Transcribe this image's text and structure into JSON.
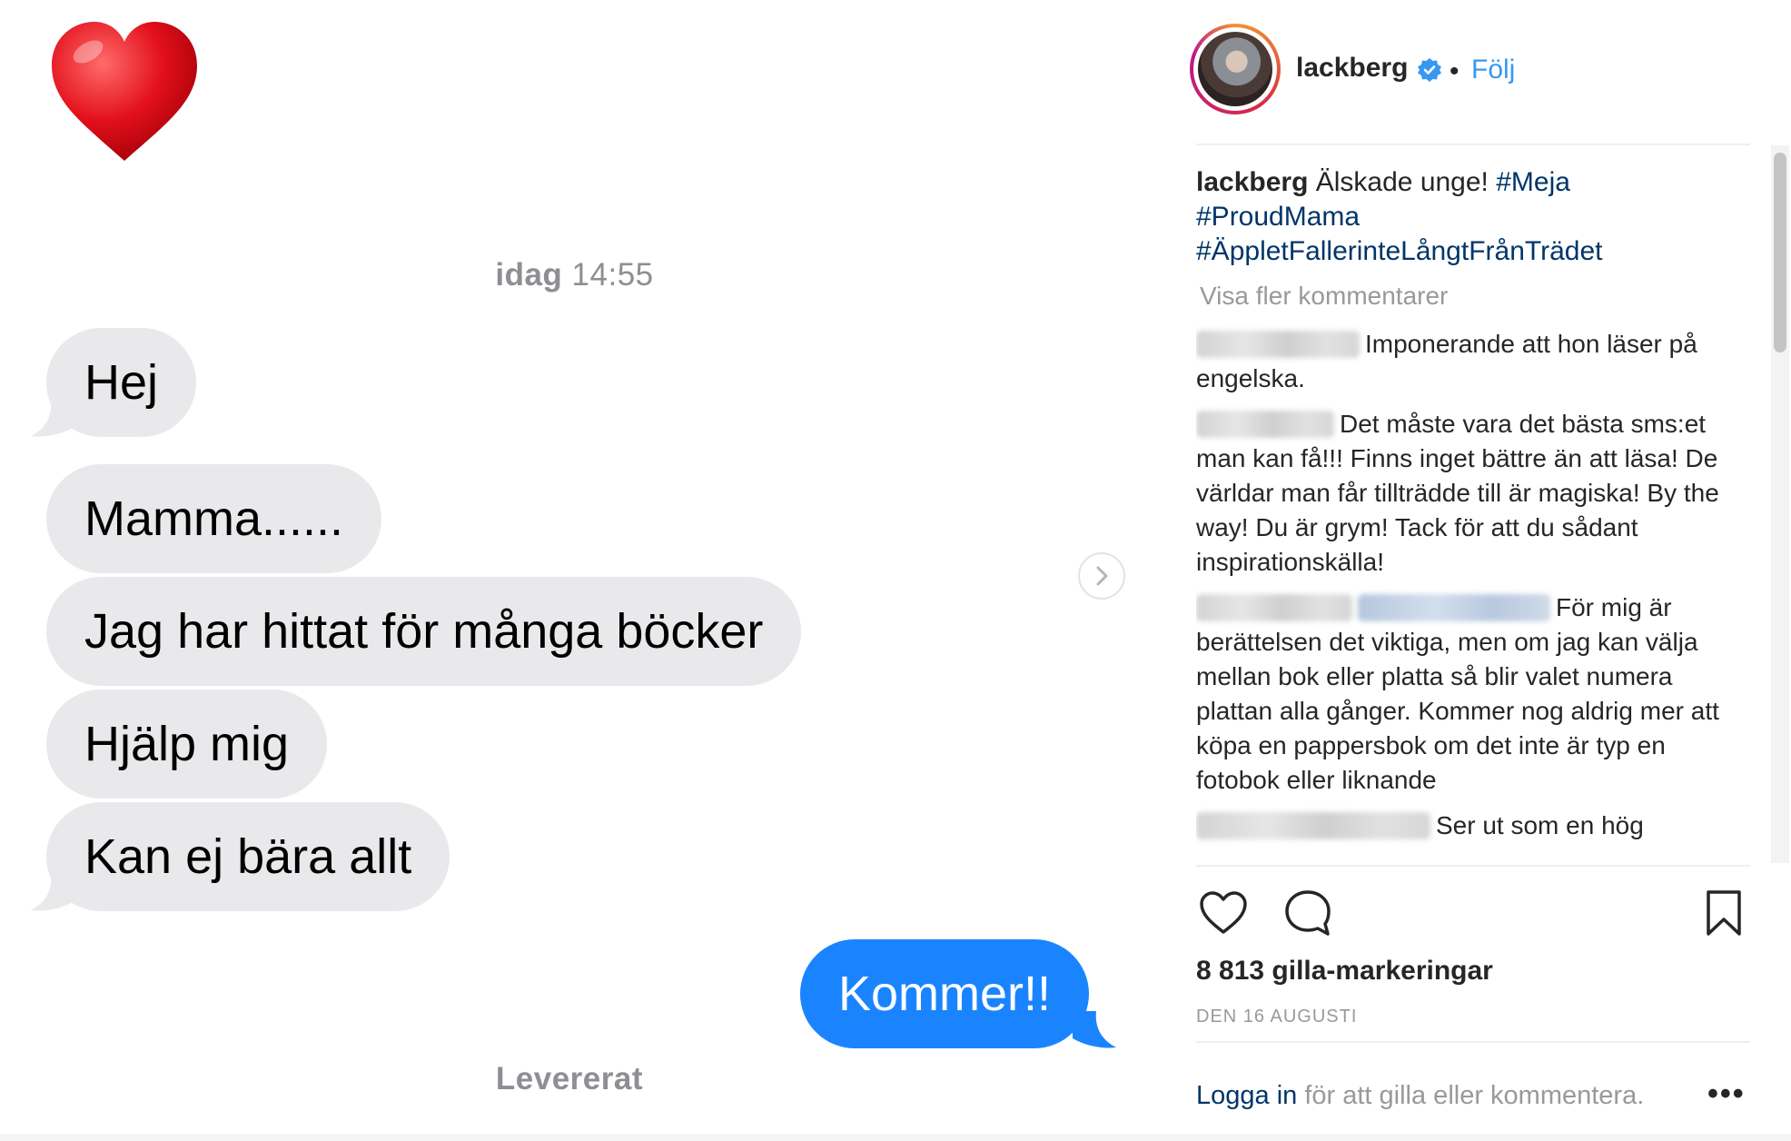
{
  "chat": {
    "timestamp_day": "idag",
    "timestamp_time": "14:55",
    "incoming": [
      "Hej",
      "Mamma......",
      "Jag har hittat för många böcker",
      "Hjälp mig",
      "Kan ej bära allt"
    ],
    "outgoing": "Kommer!!",
    "status": "Levererat",
    "colors": {
      "incoming_bubble": "#e9e9eb",
      "outgoing_bubble": "#1a84ff"
    }
  },
  "post": {
    "username": "lackberg",
    "follow_label": "Följ",
    "caption_user": "lackberg",
    "caption_text": "Älskade unge!",
    "hashtags": [
      "#Meja",
      "#ProudMama",
      "#ÄppletFallerinteLångtFrånTrädet"
    ],
    "more_comments": "Visa fler kommentarer",
    "comments": [
      "Imponerande att hon läser på engelska.",
      "Det måste vara det bästa sms:et man kan få!!! Finns inget bättre än att läsa! De världar man får tillträdde till är magiska! By the way! Du är grym! Tack för att du sådant inspirationskälla!",
      "För mig är berättelsen det viktiga, men om jag kan välja mellan bok eller platta så blir valet numera plattan alla gånger. Kommer nog aldrig mer att köpa en pappersbok om det inte är typ en fotobok eller liknande",
      "Ser ut som en hög"
    ],
    "likes": "8 813 gilla-markeringar",
    "date": "DEN 16 AUGUSTI",
    "login_link": "Logga in",
    "login_text": "för att gilla eller kommentera.",
    "more_options": "•••",
    "colors": {
      "link": "#3897f0",
      "hashtag": "#003569"
    }
  }
}
